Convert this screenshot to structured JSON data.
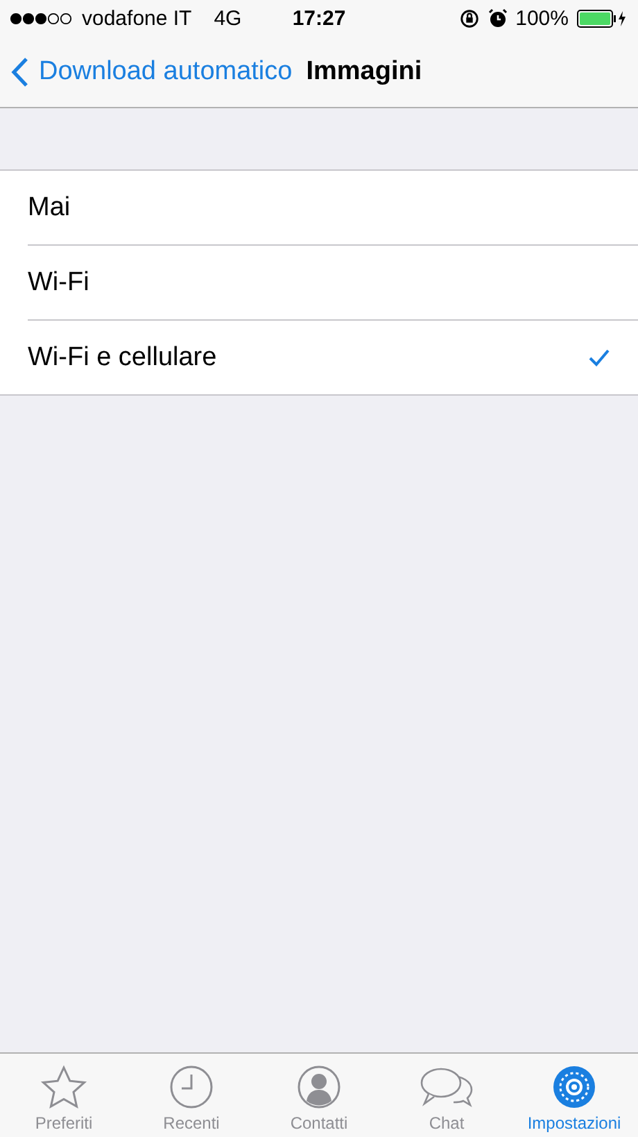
{
  "status_bar": {
    "carrier": "vodafone IT",
    "network": "4G",
    "time": "17:27",
    "battery": "100%"
  },
  "nav": {
    "back": "Download automatico",
    "title": "Immagini"
  },
  "options": [
    {
      "label": "Mai",
      "selected": false
    },
    {
      "label": "Wi-Fi",
      "selected": false
    },
    {
      "label": "Wi-Fi e cellulare",
      "selected": true
    }
  ],
  "tabs": [
    {
      "kind": "star",
      "label": "Preferiti",
      "selected": false
    },
    {
      "kind": "clock",
      "label": "Recenti",
      "selected": false
    },
    {
      "kind": "person",
      "label": "Contatti",
      "selected": false
    },
    {
      "kind": "chat",
      "label": "Chat",
      "selected": false
    },
    {
      "kind": "gear",
      "label": "Impostazioni",
      "selected": true
    }
  ]
}
